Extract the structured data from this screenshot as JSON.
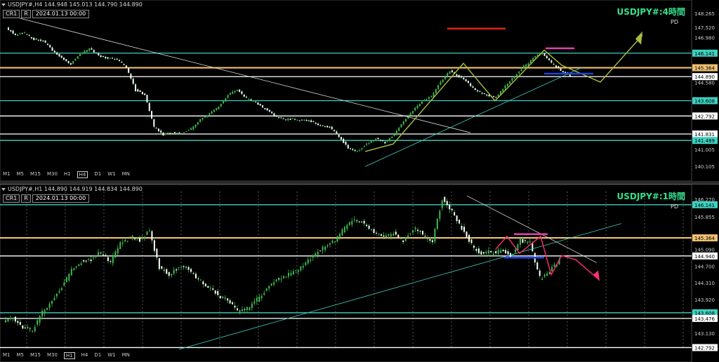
{
  "chart_data": [
    {
      "type": "candlestick",
      "symbol_header": "USDJPY#,H4  144.948 145.013 144.790 144.890",
      "title": "USDJPY#:4時間",
      "subtitle": "PD",
      "buttons": [
        "CR1",
        "R"
      ],
      "date": "2024.01.13 00:00",
      "timeframes": [
        "M1",
        "M5",
        "M15",
        "M30",
        "H1",
        "H4",
        "D1",
        "W1",
        "MN"
      ],
      "active_timeframe": "H4",
      "y_ticks": [
        "148.265",
        "147.520",
        "146.980",
        "146.141",
        "145.364",
        "144.890",
        "144.580",
        "143.608",
        "142.792",
        "141.831",
        "141.489",
        "141.005",
        "140.105"
      ],
      "levels": [
        {
          "value": 146.141,
          "label": "146.141",
          "color": "#3fd0c0"
        },
        {
          "value": 145.364,
          "label": "145.364",
          "color": "#f0c070"
        },
        {
          "value": 144.89,
          "label": "144.890",
          "color": "#ffffff"
        },
        {
          "value": 143.608,
          "label": "143.608",
          "color": "#3fd0c0"
        },
        {
          "value": 142.792,
          "label": "142.792",
          "color": "#ffffff"
        },
        {
          "value": 141.831,
          "label": "141.831",
          "color": "#ffffff"
        },
        {
          "value": 141.489,
          "label": "141.489",
          "color": "#3fd0c0"
        }
      ],
      "ylim": [
        140.0,
        148.6
      ]
    },
    {
      "type": "candlestick",
      "symbol_header": "USDJPY#,H1  144.890 144.919 144.834 144.890",
      "title": "USDJPY#:1時間",
      "subtitle": "PD",
      "buttons": [
        "CR1",
        "R"
      ],
      "date": "2024.01.13 00:00",
      "timeframes": [
        "M1",
        "M5",
        "M15",
        "M30",
        "H1",
        "H4",
        "D1",
        "W1",
        "MN"
      ],
      "active_timeframe": "H1",
      "y_ticks": [
        "146.270",
        "146.141",
        "145.855",
        "145.364",
        "145.090",
        "144.940",
        "144.700",
        "144.310",
        "143.920",
        "143.608",
        "143.476",
        "143.130",
        "142.792"
      ],
      "levels": [
        {
          "value": 146.141,
          "label": "146.141",
          "color": "#3fd0c0"
        },
        {
          "value": 145.364,
          "label": "145.364",
          "color": "#f0c070"
        },
        {
          "value": 144.94,
          "label": "144.940",
          "color": "#ffffff"
        },
        {
          "value": 143.608,
          "label": "143.608",
          "color": "#3fd0c0"
        },
        {
          "value": 143.476,
          "label": "143.476",
          "color": "#ffffff"
        },
        {
          "value": 142.792,
          "label": "142.792",
          "color": "#ffffff"
        }
      ],
      "ylim": [
        142.75,
        146.45
      ]
    }
  ]
}
